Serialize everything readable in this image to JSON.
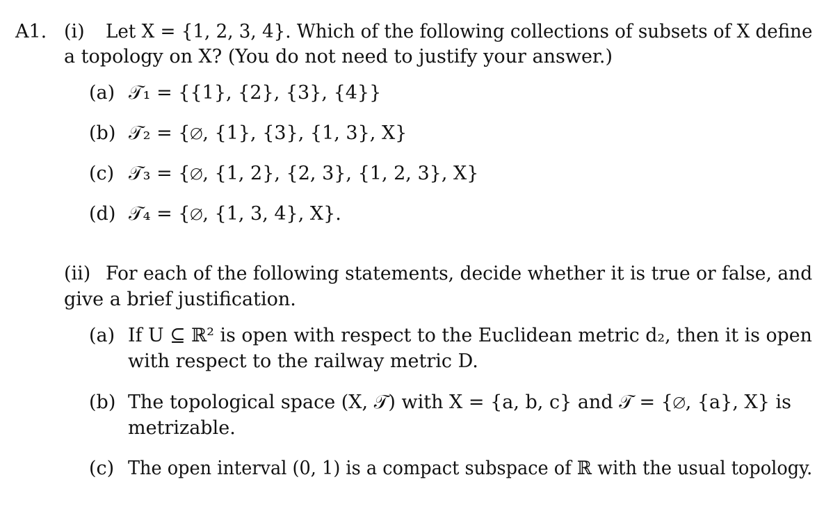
{
  "question": {
    "number": "A1.",
    "part_i": {
      "label": "(i)",
      "line1": "Let X = {1, 2, 3, 4}. Which of the following collections of subsets of X define",
      "line2": "a topology on X? (You do not need to justify your answer.)",
      "options": [
        {
          "label": "(a)",
          "text": "𝒯₁ = {{1}, {2}, {3}, {4}}"
        },
        {
          "label": "(b)",
          "text": "𝒯₂ = {∅, {1}, {3}, {1, 3}, X}"
        },
        {
          "label": "(c)",
          "text": "𝒯₃ = {∅, {1, 2}, {2, 3}, {1, 2, 3}, X}"
        },
        {
          "label": "(d)",
          "text": "𝒯₄ = {∅, {1, 3, 4}, X}."
        }
      ]
    },
    "part_ii": {
      "label": "(ii)",
      "line1": "For each of the following statements, decide whether it is true or false, and",
      "line2": "give a brief justification.",
      "statements": [
        {
          "label": "(a)",
          "line1": "If U ⊆ ℝ² is open with respect to the Euclidean metric d₂, then it is open",
          "line2": "with respect to the railway metric D."
        },
        {
          "label": "(b)",
          "line1": "The topological space (X, 𝒯) with X = {a, b, c} and 𝒯 = {∅, {a}, X} is",
          "line2": "metrizable."
        },
        {
          "label": "(c)",
          "line1": "The open interval (0, 1) is a compact subspace of ℝ with the usual topology.",
          "line2": ""
        }
      ]
    }
  }
}
